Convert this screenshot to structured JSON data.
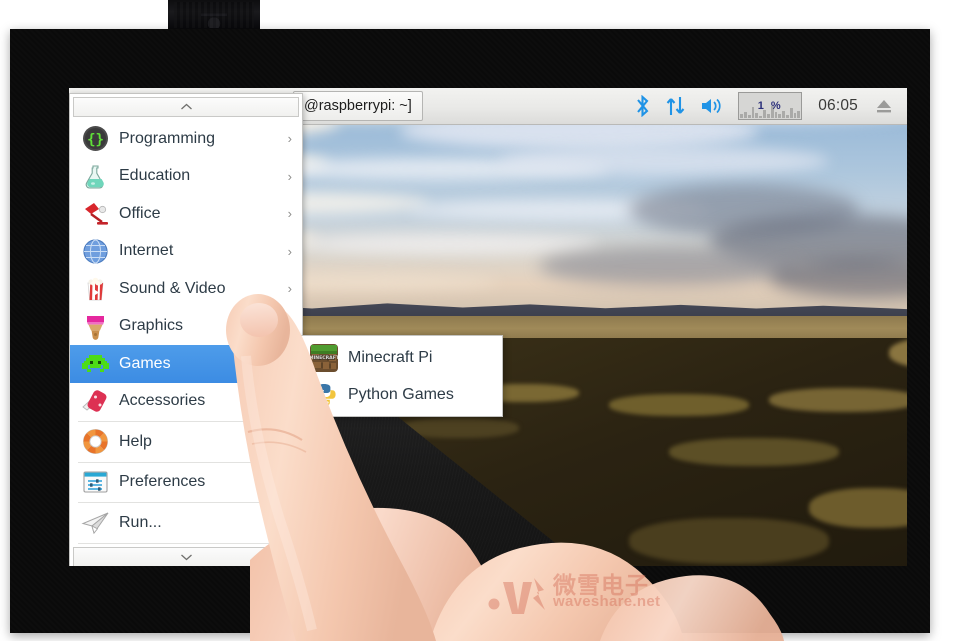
{
  "device": {
    "name": "raspberry-pi-touchscreen-display",
    "connector_label": ""
  },
  "taskbar": {
    "window_button": {
      "label": "@raspberrypi: ~]",
      "icon": "terminal-window-icon"
    },
    "tray": {
      "bluetooth": {
        "icon": "bluetooth-icon",
        "label": ""
      },
      "network": {
        "icon": "network-up-down-icon",
        "label": ""
      },
      "volume": {
        "icon": "volume-speaker-icon",
        "label": ""
      },
      "cpu_monitor": {
        "icon": "cpu-histogram-icon",
        "value": "1 %"
      },
      "clock": {
        "icon": "clock-icon",
        "value": "06:05"
      },
      "eject": {
        "icon": "eject-icon",
        "label": ""
      }
    }
  },
  "menu": {
    "scroll_up": {
      "icon": "chevron-up-icon",
      "label": ""
    },
    "scroll_down": {
      "icon": "chevron-down-icon",
      "label": ""
    },
    "items": [
      {
        "label": "Programming",
        "icon": "code-braces-icon",
        "has_submenu": true,
        "arrow": "›",
        "selected": false
      },
      {
        "label": "Education",
        "icon": "flask-icon",
        "has_submenu": true,
        "arrow": "›",
        "selected": false
      },
      {
        "label": "Office",
        "icon": "desk-lamp-icon",
        "has_submenu": true,
        "arrow": "›",
        "selected": false
      },
      {
        "label": "Internet",
        "icon": "globe-icon",
        "has_submenu": true,
        "arrow": "›",
        "selected": false
      },
      {
        "label": "Sound & Video",
        "icon": "popcorn-media-icon",
        "has_submenu": true,
        "arrow": "›",
        "selected": false
      },
      {
        "label": "Graphics",
        "icon": "paintbrush-icon",
        "has_submenu": true,
        "arrow": "›",
        "selected": false
      },
      {
        "label": "Games",
        "icon": "space-invader-icon",
        "has_submenu": true,
        "arrow": "›",
        "selected": true
      },
      {
        "label": "Accessories",
        "icon": "swiss-army-knife-icon",
        "has_submenu": false,
        "arrow": "",
        "selected": false
      },
      {
        "label": "Help",
        "icon": "lifebuoy-icon",
        "has_submenu": false,
        "arrow": "",
        "selected": false
      },
      {
        "label": "Preferences",
        "icon": "settings-window-icon",
        "has_submenu": false,
        "arrow": "",
        "selected": false
      },
      {
        "label": "Run...",
        "icon": "paper-plane-icon",
        "has_submenu": false,
        "arrow": "",
        "selected": false
      }
    ]
  },
  "submenu": {
    "parent": "Games",
    "items": [
      {
        "label": "Minecraft Pi",
        "icon": "minecraft-grass-block-icon"
      },
      {
        "label": "Python Games",
        "icon": "python-logo-icon"
      }
    ]
  },
  "desktop": {
    "wallpaper_name": "road-at-sunset-wallpaper"
  },
  "touch": {
    "indicator": "touch-ripple-indicator",
    "pointer": "finger-pointer"
  },
  "watermark": {
    "chinese": "微雪电子",
    "english": "waveshare.net",
    "logo": "waveshare-logo-icon"
  },
  "colors": {
    "menu_highlight": "#3c8ce3",
    "taskbar_bg": "#ececea",
    "tray_icon": "#2196e8",
    "bezel": "#0a0a0a",
    "watermark": "#d36b55"
  }
}
